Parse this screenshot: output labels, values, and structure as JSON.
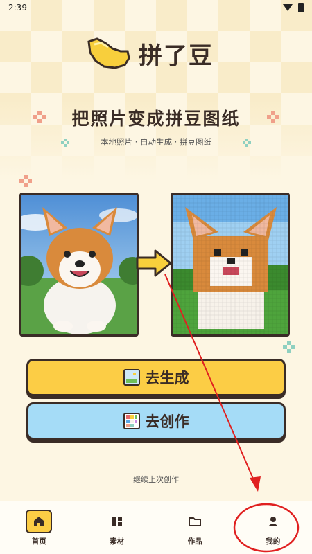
{
  "status_bar": {
    "time": "2:39"
  },
  "app": {
    "logo_text": "拼了豆"
  },
  "hero": {
    "headline": "把照片变成拼豆图纸",
    "tagline": "本地照片 · 自动生成 · 拼豆图纸"
  },
  "actions": {
    "generate_label": "去生成",
    "create_label": "去创作",
    "continue_label": "继续上次创作"
  },
  "bottom_nav": {
    "items": [
      {
        "label": "首页",
        "icon": "home-icon",
        "active": true
      },
      {
        "label": "素材",
        "icon": "grid-icon",
        "active": false
      },
      {
        "label": "作品",
        "icon": "folder-icon",
        "active": false
      },
      {
        "label": "我的",
        "icon": "person-icon",
        "active": false
      }
    ]
  },
  "colors": {
    "accent_yellow": "#fccd45",
    "accent_blue": "#a5dcf7",
    "outline": "#3a2c26",
    "annotation_red": "#e02020"
  }
}
